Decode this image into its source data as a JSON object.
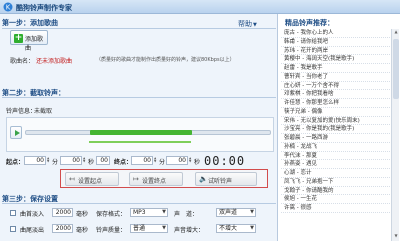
{
  "window": {
    "title": "酷狗铃声制作专家"
  },
  "help": {
    "label": "帮助"
  },
  "step1": {
    "title": "第一步：添加歌曲",
    "add_button": "添加歌曲",
    "song_label": "歌曲名：",
    "song_value": "还未添加歌曲",
    "note": "（质量好的歌曲才能制作出质量好的铃声，建议80Kbps以上）"
  },
  "step2": {
    "title": "第二步：截取铃声：",
    "ring_info_label": "铃声信息：",
    "ring_info_value": "未截取",
    "start_label": "起点：",
    "end_label": "终点：",
    "start": {
      "h": "00",
      "m": "00",
      "s": "00"
    },
    "end": {
      "h": "00",
      "m": "00",
      "s": "00"
    },
    "unit_min": "分",
    "unit_sec": "秒",
    "current_time": "00:00",
    "buttons": {
      "set_start": "设置起点",
      "set_end": "设置终点",
      "preview": "试听铃声"
    }
  },
  "step3": {
    "title": "第三步：保存设置",
    "fade_in_label": "曲首淡入",
    "fade_in_value": "2000",
    "fade_out_label": "曲尾淡出",
    "fade_out_value": "2000",
    "ms": "毫秒",
    "format_label": "保存格式：",
    "format_value": "MP3",
    "channel_label": "声　道：",
    "channel_value": "双声道",
    "quality_label": "铃声质量：",
    "quality_value": "普通",
    "volume_label": "声音增大：",
    "volume_value": "不增大"
  },
  "recommend": {
    "title": "精品铃声推荐：",
    "items": [
      "庞古 - 我你心上的人",
      "韩甫 - 请你给我吧",
      "苏玮 - 花开的两岸",
      "黄樱中 - 海阔天空(我是歌手)",
      "赵雷 - 我是歌手",
      "曹轩宾 - 当你老了",
      "庄心妍 - 一万个舍不得",
      "邓紫棋 - 你把我看啥",
      "许佳慧 - 你那里怎么样",
      "筷子兄弟 - 偶像",
      "宋伟 - 无以复加的爱(快乐周末)",
      "沙宝亮 - 你是我的(我是歌手)",
      "张碧晨 - 一路西游",
      "孙楠 - 龙战飞",
      "李代沫 - 那夏",
      "孙燕姿 - 遇见",
      "心湖 - 恋计",
      "凤飞飞 - 兄弟抱一下",
      "戈翰子 - 你请酷我的",
      "侯旭 - 一生花",
      "许嵩 - 很感"
    ]
  },
  "colors": {
    "accent": "#1f4e86",
    "progress": "#45b532",
    "highlight_border": "#d24c4c",
    "title_bar": "#c7dcf2"
  }
}
